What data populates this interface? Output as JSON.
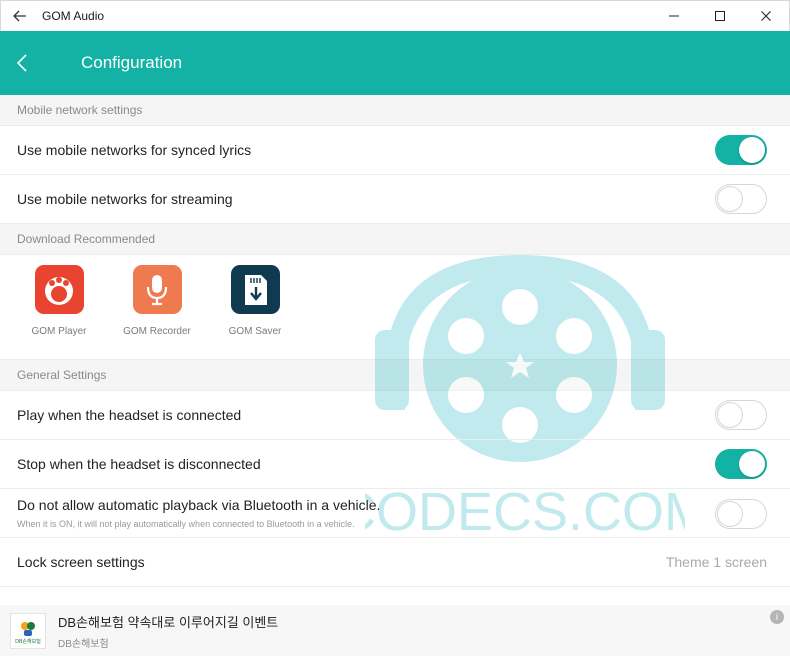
{
  "window": {
    "title": "GOM Audio"
  },
  "header": {
    "title": "Configuration"
  },
  "sections": {
    "mobile_network": {
      "header": "Mobile network settings",
      "items": [
        {
          "label": "Use mobile networks for synced lyrics",
          "enabled": true
        },
        {
          "label": "Use mobile networks for streaming",
          "enabled": false
        }
      ]
    },
    "download": {
      "header": "Download Recommended",
      "apps": [
        {
          "name": "GOM Player",
          "icon": "gom-player-icon",
          "color": "#e8442f"
        },
        {
          "name": "GOM Recorder",
          "icon": "gom-recorder-icon",
          "color": "#f07a50"
        },
        {
          "name": "GOM Saver",
          "icon": "gom-saver-icon",
          "color": "#0f3a4f"
        }
      ]
    },
    "general": {
      "header": "General Settings",
      "items": [
        {
          "label": "Play when the headset is connected",
          "enabled": false
        },
        {
          "label": "Stop when the headset is disconnected",
          "enabled": true
        },
        {
          "label": "Do not allow automatic playback via Bluetooth in a vehicle.",
          "sublabel": "When it is ON, it will not play automatically when connected to Bluetooth in a vehicle.",
          "enabled": false
        }
      ],
      "lock_screen": {
        "label": "Lock screen settings",
        "value": "Theme 1 screen"
      }
    }
  },
  "watermark": {
    "text": "CODECS.COM"
  },
  "ad": {
    "logo_text": "DB손해보험",
    "title": "DB손해보험 약속대로 이루어지길 이벤트",
    "subtitle": "DB손해보험",
    "info": "i"
  },
  "colors": {
    "accent": "#13b2a5",
    "watermark": "#3fc1c9"
  }
}
